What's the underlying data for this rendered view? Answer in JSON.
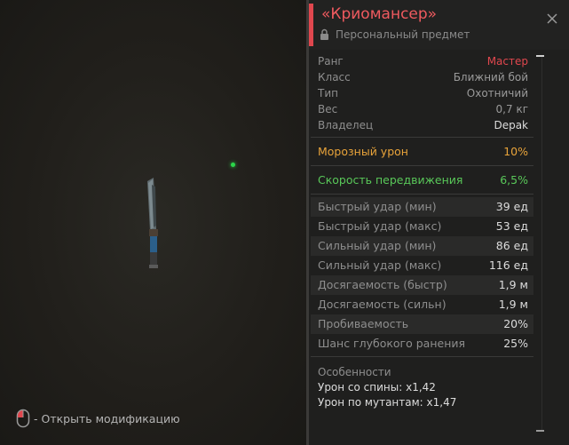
{
  "hint": {
    "text": "- Открыть модификацию"
  },
  "item": {
    "title": "«Криомансер»",
    "subtitle": "Персональный предмет"
  },
  "info": [
    {
      "label": "Ранг",
      "value": "Мастер",
      "color": "#e0474e"
    },
    {
      "label": "Класс",
      "value": "Ближний бой",
      "color": "#9a9a9a"
    },
    {
      "label": "Тип",
      "value": "Охотничий",
      "color": "#9a9a9a"
    },
    {
      "label": "Вес",
      "value": "0,7 кг",
      "color": "#9a9a9a"
    },
    {
      "label": "Владелец",
      "value": "Depak",
      "color": "#dcdcdc"
    }
  ],
  "modifiers": [
    {
      "label": "Морозный урон",
      "value": "10%",
      "color": "#e8a33a"
    },
    {
      "label": "Скорость передвижения",
      "value": "6,5%",
      "color": "#59c859"
    }
  ],
  "stats": [
    {
      "label": "Быстрый удар (мин)",
      "value": "39 ед"
    },
    {
      "label": "Быстрый удар (макс)",
      "value": "53 ед"
    },
    {
      "label": "Сильный удар (мин)",
      "value": "86 ед"
    },
    {
      "label": "Сильный удар (макс)",
      "value": "116 ед"
    },
    {
      "label": "Досягаемость (быстр)",
      "value": "1,9 м"
    },
    {
      "label": "Досягаемость (сильн)",
      "value": "1,9 м"
    },
    {
      "label": "Пробиваемость",
      "value": "20%"
    },
    {
      "label": "Шанс глубокого ранения",
      "value": "25%"
    }
  ],
  "features": {
    "title": "Особенности",
    "lines": [
      "Урон со спины: x1,42",
      "Урон по мутантам: x1,47"
    ]
  },
  "icons": {
    "close": "close-icon",
    "lock": "lock-icon",
    "mouse": "mouse-icon",
    "item": "knife-icon"
  }
}
